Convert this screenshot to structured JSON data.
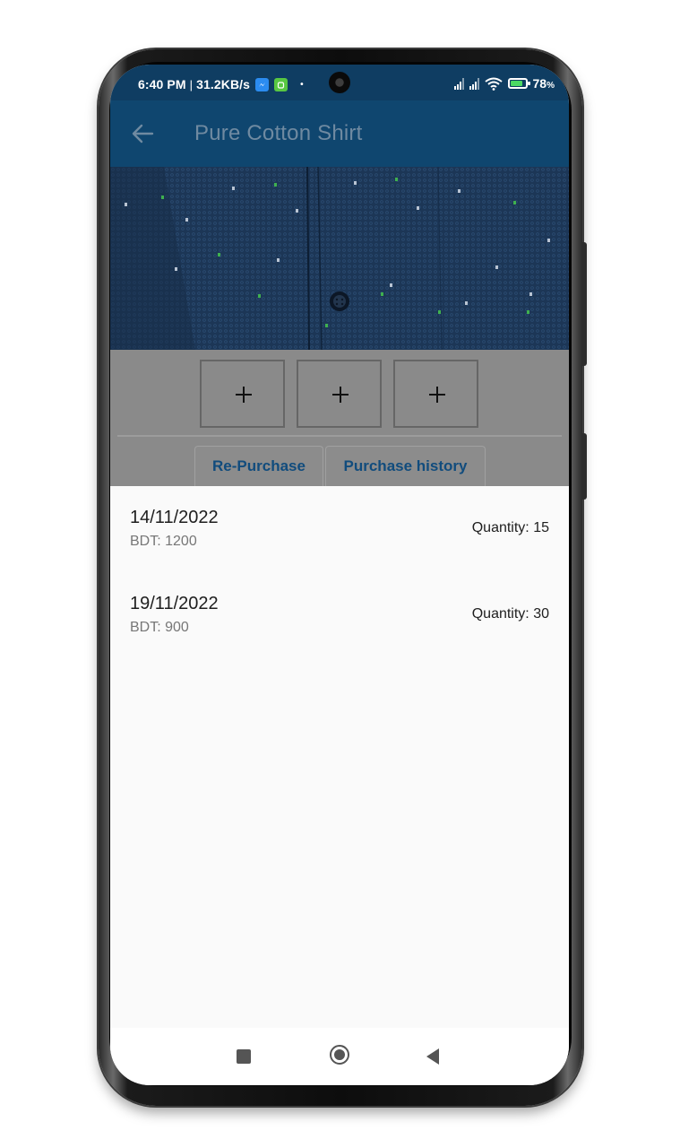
{
  "status_bar": {
    "time": "6:40 PM",
    "separator": "|",
    "network_speed": "31.2KB/s",
    "dot": "•",
    "battery": "78",
    "battery_unit": "%",
    "icons": [
      "messenger-icon",
      "android-icon",
      "signal-icon",
      "signal-icon",
      "wifi-icon",
      "battery-charging-icon"
    ]
  },
  "app_bar": {
    "title": "Pure Cotton Shirt",
    "back_icon": "arrow-back-icon",
    "background_color": "#0f466f"
  },
  "product_image": {
    "description_icon": "shirt-fabric-image"
  },
  "image_slots": [
    {
      "label": "+"
    },
    {
      "label": "+"
    },
    {
      "label": "+"
    }
  ],
  "tabs": [
    {
      "label": "Re-Purchase"
    },
    {
      "label": "Purchase history"
    }
  ],
  "purchases": [
    {
      "date": "14/11/2022",
      "price": "BDT: 1200",
      "quantity": "Quantity: 15"
    },
    {
      "date": "19/11/2022",
      "price": "BDT: 900",
      "quantity": "Quantity: 30"
    }
  ],
  "nav_bar": {
    "icons": [
      "recent-apps-icon",
      "home-icon",
      "back-icon"
    ]
  },
  "colors": {
    "accent": "#114c7d",
    "overlay": "#8a8a8a"
  }
}
